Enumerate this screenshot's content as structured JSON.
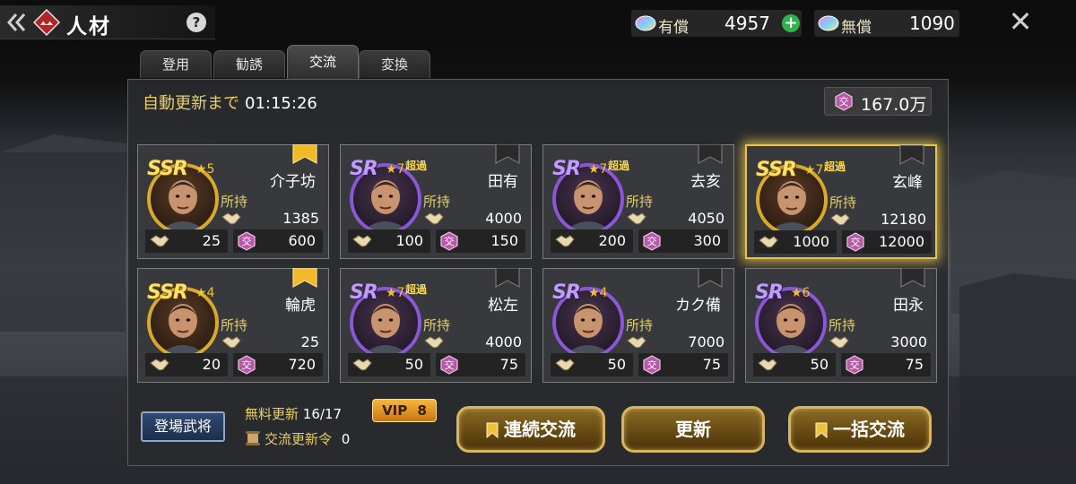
{
  "header": {
    "title": "人材",
    "help_icon": "?",
    "close_icon": "✕",
    "paid_label": "有償",
    "paid_value": "4957",
    "free_label": "無償",
    "free_value": "1090",
    "plus": "+"
  },
  "tabs": [
    {
      "label": "登用",
      "active": false
    },
    {
      "label": "勧誘",
      "active": false
    },
    {
      "label": "交流",
      "active": true
    },
    {
      "label": "変換",
      "active": false
    }
  ],
  "panel": {
    "auto_refresh_label": "自動更新まで",
    "auto_refresh_time": "01:15:26",
    "points_value": "167.0万",
    "owned_label": "所持",
    "exchange_glyph": "交"
  },
  "cards": [
    {
      "rarity": "SSR",
      "stars": "5",
      "over": "",
      "name": "介子坊",
      "owned": "1385",
      "handshake": "25",
      "cost": "600",
      "bookmark": "gold",
      "highlight": false
    },
    {
      "rarity": "SR",
      "stars": "7",
      "over": "超過",
      "name": "田有",
      "owned": "4000",
      "handshake": "100",
      "cost": "150",
      "bookmark": "dark",
      "highlight": false
    },
    {
      "rarity": "SR",
      "stars": "7",
      "over": "超過",
      "name": "去亥",
      "owned": "4050",
      "handshake": "200",
      "cost": "300",
      "bookmark": "dark",
      "highlight": false
    },
    {
      "rarity": "SSR",
      "stars": "7",
      "over": "超過",
      "name": "玄峰",
      "owned": "12180",
      "handshake": "1000",
      "cost": "12000",
      "bookmark": "dark",
      "highlight": true
    },
    {
      "rarity": "SSR",
      "stars": "4",
      "over": "",
      "name": "輪虎",
      "owned": "25",
      "handshake": "20",
      "cost": "720",
      "bookmark": "gold",
      "highlight": false
    },
    {
      "rarity": "SR",
      "stars": "7",
      "over": "超過",
      "name": "松左",
      "owned": "4000",
      "handshake": "50",
      "cost": "75",
      "bookmark": "dark",
      "highlight": false
    },
    {
      "rarity": "SR",
      "stars": "4",
      "over": "",
      "name": "カク備",
      "owned": "7000",
      "handshake": "50",
      "cost": "75",
      "bookmark": "dark",
      "highlight": false
    },
    {
      "rarity": "SR",
      "stars": "6",
      "over": "",
      "name": "田永",
      "owned": "3000",
      "handshake": "50",
      "cost": "75",
      "bookmark": "dark",
      "highlight": false
    }
  ],
  "footer": {
    "debut_label": "登場武将",
    "free_refresh_label": "無料更新",
    "free_refresh_value": "16/17",
    "vip_label": "VIP",
    "vip_level": "8",
    "refresh_token_label": "交流更新令",
    "refresh_token_value": "0",
    "btn_continuous": "連続交流",
    "btn_refresh": "更新",
    "btn_bulk": "一括交流"
  },
  "colors": {
    "gold_accent": "#e6cf6a",
    "ssr_frame": "#d9a92a",
    "sr_frame": "#8a57d6",
    "highlight_glow": "#e9c44a",
    "plus_green": "#2fb34a"
  },
  "icons": {
    "back": "double-chevron-left-icon",
    "logo": "clan-emblem-icon",
    "gem": "rainbow-gem-icon",
    "handshake": "handshake-icon",
    "exchange": "exchange-token-icon",
    "bookmark": "bookmark-icon"
  }
}
